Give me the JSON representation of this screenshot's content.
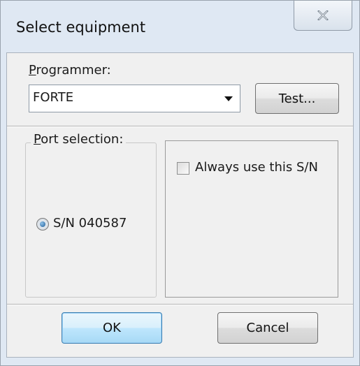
{
  "window": {
    "title": "Select equipment"
  },
  "programmer": {
    "label": "Programmer:",
    "selected": "FORTE"
  },
  "test_button": {
    "label": "Test..."
  },
  "port": {
    "label": "Port selection:",
    "option_label": "S/N 040587",
    "option_selected": true
  },
  "always_use": {
    "label": "Always use this S/N",
    "checked": false
  },
  "buttons": {
    "ok": "OK",
    "cancel": "Cancel"
  },
  "icons": {
    "close": "close-icon",
    "dropdown": "chevron-down-icon"
  },
  "colors": {
    "window_frame": "#dfe8f3",
    "client_bg": "#f0f0f0",
    "default_button_border": "#3c7fb1"
  }
}
